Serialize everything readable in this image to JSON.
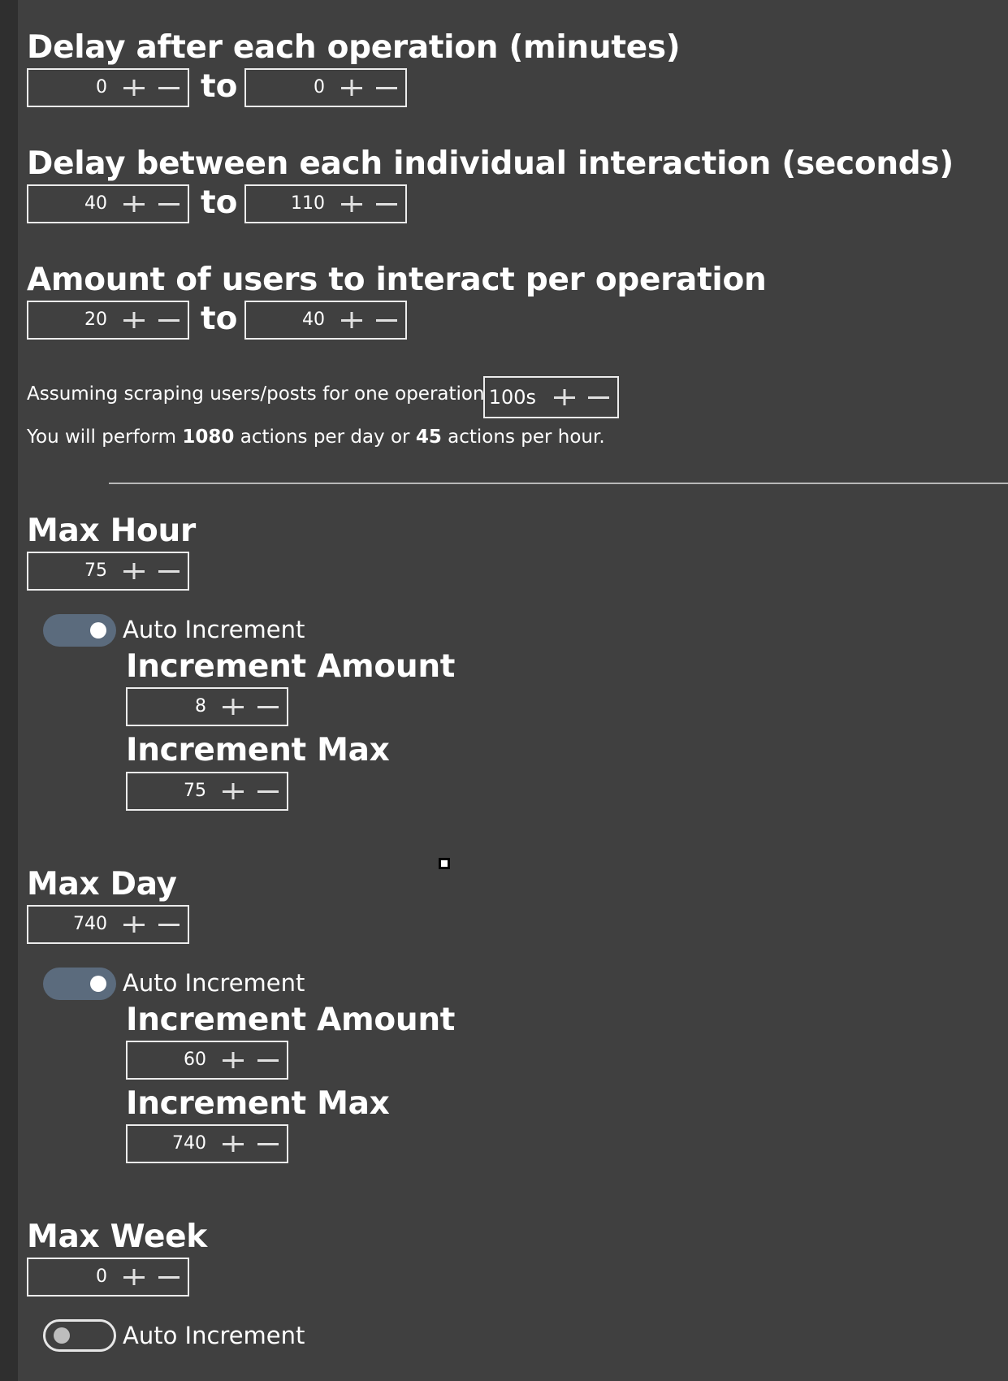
{
  "delay_operation": {
    "title": "Delay after each operation (minutes)",
    "min": "0",
    "max": "0",
    "to_label": "to"
  },
  "delay_interaction": {
    "title": "Delay between each individual interaction (seconds)",
    "min": "40",
    "max": "110",
    "to_label": "to"
  },
  "users_per_operation": {
    "title": "Amount of users to interact per operation",
    "min": "20",
    "max": "40",
    "to_label": "to"
  },
  "scraping": {
    "label": "Assuming scraping users/posts for one operation is",
    "value": "100s"
  },
  "summary": {
    "prefix": "You will perform",
    "per_day": "1080",
    "middle": "actions per day or",
    "per_hour": "45",
    "suffix": "actions per hour."
  },
  "max_hour": {
    "title": "Max Hour",
    "value": "75",
    "auto_increment_label": "Auto Increment",
    "auto_increment_on": true,
    "increment_amount_title": "Increment Amount",
    "increment_amount": "8",
    "increment_max_title": "Increment Max",
    "increment_max": "75"
  },
  "max_day": {
    "title": "Max Day",
    "value": "740",
    "auto_increment_label": "Auto Increment",
    "auto_increment_on": true,
    "increment_amount_title": "Increment Amount",
    "increment_amount": "60",
    "increment_max_title": "Increment Max",
    "increment_max": "740"
  },
  "max_week": {
    "title": "Max Week",
    "value": "0",
    "auto_increment_label": "Auto Increment",
    "auto_increment_on": false
  },
  "icons": {
    "increment": "plus-icon",
    "decrement": "minus-icon"
  },
  "colors": {
    "background": "#404040",
    "left_bar": "#2f2f2f",
    "toggle_on": "#5b6b7d",
    "text": "#ffffff"
  }
}
